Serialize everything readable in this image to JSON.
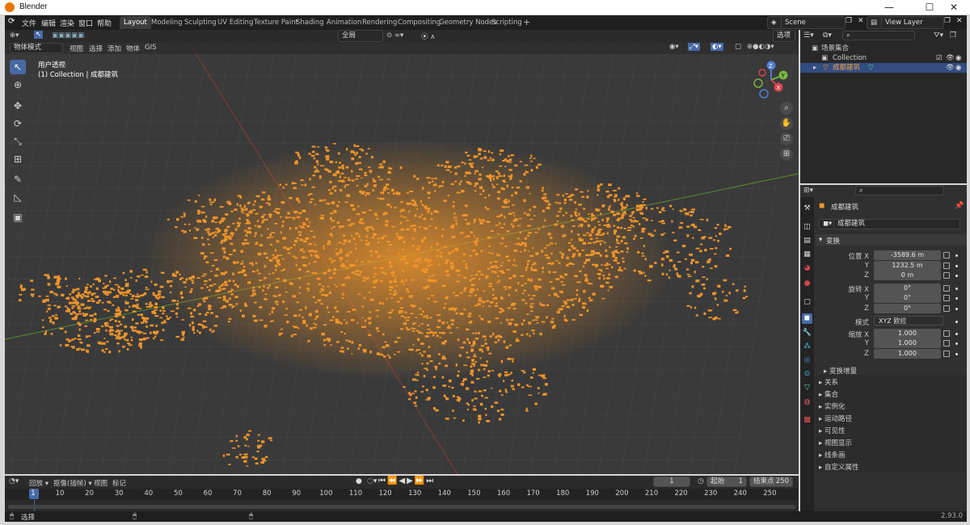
{
  "window": {
    "title": "Blender",
    "controls": [
      "—",
      "☐",
      "✕"
    ]
  },
  "menu": {
    "items": [
      "文件",
      "编辑",
      "渲染",
      "窗口",
      "帮助"
    ]
  },
  "workspaces": {
    "tabs": [
      "Layout",
      "Modeling",
      "Sculpting",
      "UV Editing",
      "Texture Paint",
      "Shading",
      "Animation",
      "Rendering",
      "Compositing",
      "Geometry Nodes",
      "Scripting"
    ],
    "active": "Layout",
    "add": "+"
  },
  "scene": {
    "name": "Scene",
    "view_layer": "View Layer"
  },
  "viewport": {
    "mode": "物体模式",
    "menus": [
      "视图",
      "选择",
      "添加",
      "物体",
      "GIS"
    ],
    "orientation": "全局",
    "select_label": "选项",
    "overlay_title": "用户透视",
    "overlay_sub": "(1) Collection | 成都建筑",
    "gizmo": {
      "z": "Z",
      "y": "Y",
      "x": "X"
    }
  },
  "outliner": {
    "rows": [
      {
        "label": "场景集合"
      },
      {
        "label": "Collection"
      },
      {
        "label": "成都建筑"
      }
    ]
  },
  "properties": {
    "object_name": "成都建筑",
    "data_name": "成都建筑",
    "section_transform": "变换",
    "location": {
      "label_x": "位置 X",
      "label_y": "Y",
      "label_z": "Z",
      "x": "-3589.6 m",
      "y": "1232.5 m",
      "z": "0 m"
    },
    "rotation": {
      "label_x": "旋转 X",
      "label_y": "Y",
      "label_z": "Z",
      "x": "0°",
      "y": "0°",
      "z": "0°"
    },
    "mode": {
      "label": "模式",
      "value": "XYZ 欧拉"
    },
    "scale": {
      "label_x": "缩放 X",
      "label_y": "Y",
      "label_z": "Z",
      "x": "1.000",
      "y": "1.000",
      "z": "1.000"
    },
    "delta": "变换增量",
    "sections": [
      "关系",
      "集合",
      "实例化",
      "运动路径",
      "可见性",
      "视图显示",
      "线条画",
      "自定义属性"
    ]
  },
  "timeline": {
    "menus": [
      "回放",
      "抠像(插帧)",
      "视图",
      "标记"
    ],
    "current_frame": "1",
    "start_label": "起始",
    "start": "1",
    "end_label": "结束点",
    "end": "250",
    "ticks": [
      "1",
      "10",
      "20",
      "30",
      "40",
      "50",
      "60",
      "70",
      "80",
      "90",
      "100",
      "110",
      "120",
      "130",
      "140",
      "150",
      "160",
      "170",
      "180",
      "190",
      "200",
      "210",
      "220",
      "230",
      "240",
      "250"
    ]
  },
  "status": {
    "select": "选择",
    "version": "2.93.0"
  },
  "colors": {
    "accent": "#476aa6",
    "buildings": "#f0952a",
    "selected": "#f0952a"
  }
}
